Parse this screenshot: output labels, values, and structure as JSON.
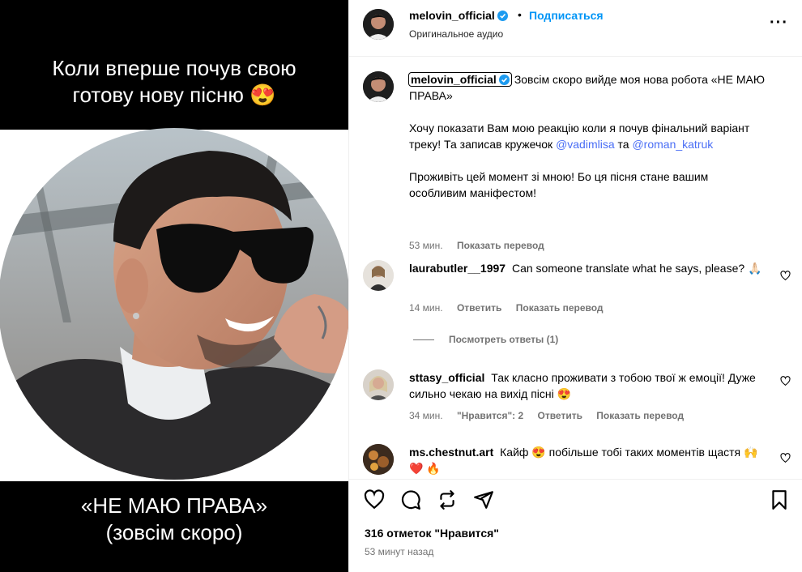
{
  "media": {
    "caption_top": [
      "Коли вперше почув свою",
      "готову нову пісню 😍"
    ],
    "caption_bottom": [
      "«НЕ МАЮ ПРАВА»",
      "(зовсім скоро)"
    ]
  },
  "header": {
    "username": "melovin_official",
    "separator": "•",
    "follow_label": "Подписаться",
    "audio_label": "Оригинальное аудио",
    "more_icon": "more-horizontal-icon"
  },
  "post": {
    "username": "melovin_official",
    "text_1": "Зовсім скоро вийде моя нова робота «НЕ МАЮ ПРАВА»",
    "text_2a": "Хочу показати Вам мою реакцію коли я почув фінальний варіант треку! Та записав кружечок",
    "mention_1": "@vadimlisa",
    "text_2b": "та",
    "mention_2": "@roman_katruk",
    "text_3": "Проживіть цей момент зі мною! Бо ця пісня стане вашим особливим маніфестом!",
    "time": "53 мин.",
    "translate_label": "Показать перевод"
  },
  "comments": [
    {
      "username": "laurabutler__1997",
      "text": "Can someone translate what he says, please? 🙏🏻",
      "time": "14 мин.",
      "reply_label": "Ответить",
      "translate_label": "Показать перевод",
      "view_replies": "Посмотреть ответы (1)"
    },
    {
      "username": "sttasy_official",
      "text": "Так класно проживати з тобою твої ж емоції! Дуже сильно чекаю на вихід пісні 😍",
      "time": "34 мин.",
      "likes_label": "\"Нравится\": 2",
      "reply_label": "Ответить",
      "translate_label": "Показать перевод"
    },
    {
      "username": "ms.chestnut.art",
      "text": "Кайф 😍 побільше тобі таких моментів щастя 🙌 ❤️ 🔥"
    }
  ],
  "footer": {
    "likes": "316 отметок \"Нравится\"",
    "time_ago": "53 минут назад"
  },
  "colors": {
    "accent": "#0095f6",
    "mention": "#4a6ef5",
    "muted": "#737373",
    "verified": "#1d9bf0"
  }
}
